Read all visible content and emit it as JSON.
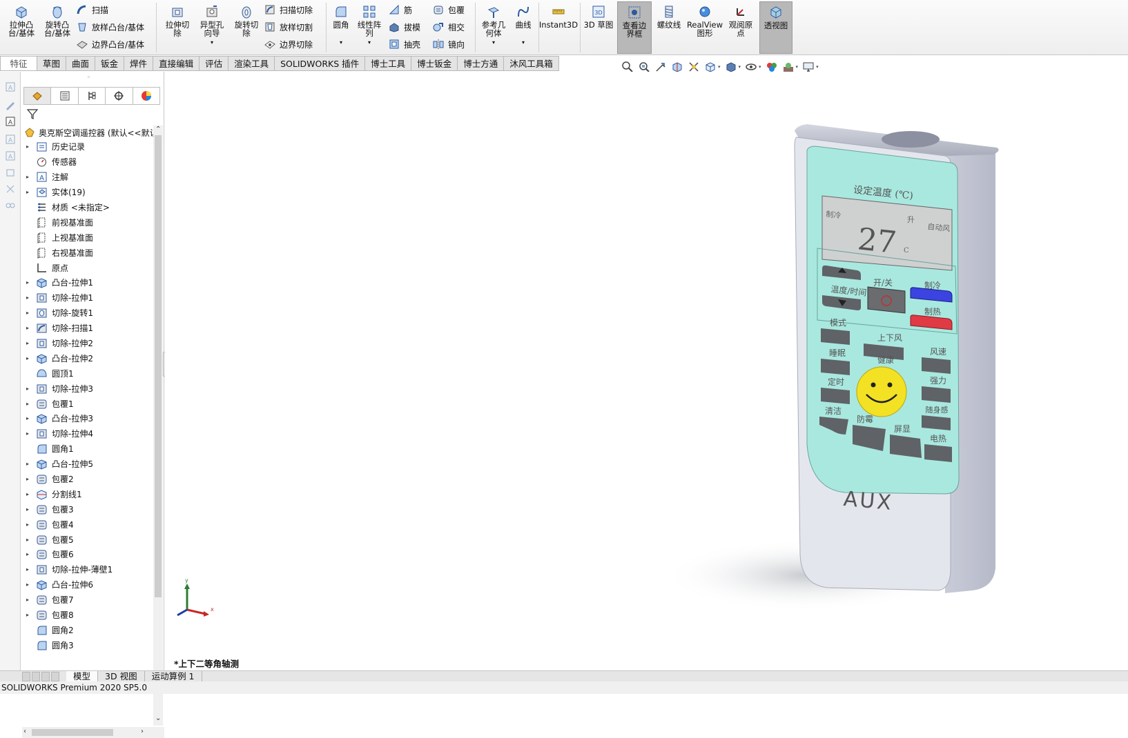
{
  "ribbon": {
    "extrude_boss": "拉伸凸\n台/基体",
    "revolve_boss": "旋转凸\n台/基体",
    "sweep": "扫描",
    "loft_boss": "放样凸台/基体",
    "boundary_boss": "边界凸台/基体",
    "extrude_cut": "拉伸切\n除",
    "hole_wizard": "异型孔\n向导",
    "revolve_cut": "旋转切\n除",
    "swept_cut": "扫描切除",
    "lofted_cut": "放样切割",
    "boundary_cut": "边界切除",
    "fillet": "圆角",
    "linear_pattern": "线性阵\n列",
    "rib": "筋",
    "draft": "拔模",
    "shell": "抽壳",
    "wrap": "包覆",
    "intersect": "相交",
    "mirror": "镜向",
    "ref_geometry": "参考几\n何体",
    "curves": "曲线",
    "instant3d": "Instant3D",
    "sketch3d": "3D 草图",
    "bounding_box": "查看边\n界框",
    "thread": "螺纹线",
    "realview": "RealView\n图形",
    "view_origin": "观阅原\n点",
    "transparent": "透视图"
  },
  "command_tabs": [
    "特征",
    "草图",
    "曲面",
    "钣金",
    "焊件",
    "直接编辑",
    "评估",
    "渲染工具",
    "SOLIDWORKS 插件",
    "博士工具",
    "博士钣金",
    "博士方通",
    "沐风工具箱"
  ],
  "tree": {
    "root": "奥克斯空调遥控器 (默认<<默认",
    "items": [
      {
        "label": "历史记录",
        "icon": "history-icon",
        "expand": true
      },
      {
        "label": "传感器",
        "icon": "sensor-icon",
        "expand": false
      },
      {
        "label": "注解",
        "icon": "annotation-icon",
        "expand": true
      },
      {
        "label": "实体(19)",
        "icon": "solid-bodies-icon",
        "expand": true
      },
      {
        "label": "材质 <未指定>",
        "icon": "material-icon",
        "expand": false
      },
      {
        "label": "前视基准面",
        "icon": "plane-icon",
        "expand": false
      },
      {
        "label": "上视基准面",
        "icon": "plane-icon",
        "expand": false
      },
      {
        "label": "右视基准面",
        "icon": "plane-icon",
        "expand": false
      },
      {
        "label": "原点",
        "icon": "origin-icon",
        "expand": false
      },
      {
        "label": "凸台-拉伸1",
        "icon": "boss-extrude-icon",
        "expand": true
      },
      {
        "label": "切除-拉伸1",
        "icon": "cut-extrude-icon",
        "expand": true
      },
      {
        "label": "切除-旋转1",
        "icon": "cut-revolve-icon",
        "expand": true
      },
      {
        "label": "切除-扫描1",
        "icon": "cut-sweep-icon",
        "expand": true
      },
      {
        "label": "切除-拉伸2",
        "icon": "cut-extrude-icon",
        "expand": true
      },
      {
        "label": "凸台-拉伸2",
        "icon": "boss-extrude-icon",
        "expand": true
      },
      {
        "label": "圆顶1",
        "icon": "dome-icon",
        "expand": false
      },
      {
        "label": "切除-拉伸3",
        "icon": "cut-extrude-icon",
        "expand": true
      },
      {
        "label": "包覆1",
        "icon": "wrap-icon",
        "expand": true
      },
      {
        "label": "凸台-拉伸3",
        "icon": "boss-extrude-icon",
        "expand": true
      },
      {
        "label": "切除-拉伸4",
        "icon": "cut-extrude-icon",
        "expand": true
      },
      {
        "label": "圆角1",
        "icon": "fillet-icon",
        "expand": false
      },
      {
        "label": "凸台-拉伸5",
        "icon": "boss-extrude-icon",
        "expand": true
      },
      {
        "label": "包覆2",
        "icon": "wrap-icon",
        "expand": true
      },
      {
        "label": "分割线1",
        "icon": "split-line-icon",
        "expand": true
      },
      {
        "label": "包覆3",
        "icon": "wrap-icon",
        "expand": true
      },
      {
        "label": "包覆4",
        "icon": "wrap-icon",
        "expand": true
      },
      {
        "label": "包覆5",
        "icon": "wrap-icon",
        "expand": true
      },
      {
        "label": "包覆6",
        "icon": "wrap-icon",
        "expand": true
      },
      {
        "label": "切除-拉伸-薄壁1",
        "icon": "cut-extrude-icon",
        "expand": true
      },
      {
        "label": "凸台-拉伸6",
        "icon": "boss-extrude-icon",
        "expand": true
      },
      {
        "label": "包覆7",
        "icon": "wrap-icon",
        "expand": true
      },
      {
        "label": "包覆8",
        "icon": "wrap-icon",
        "expand": true
      },
      {
        "label": "圆角2",
        "icon": "fillet-icon",
        "expand": false
      },
      {
        "label": "圆角3",
        "icon": "fillet-icon",
        "expand": false
      }
    ]
  },
  "model": {
    "screen_title": "设定温度 (℃)",
    "mode_cool": "制冷",
    "temp_value": "27",
    "temp_unit": "C",
    "rise_label": "升",
    "auto_label": "自动风",
    "btn_temp_time": "温度/时间",
    "btn_onoff": "开/关",
    "btn_cool": "制冷",
    "btn_heat": "制热",
    "btn_mode": "模式",
    "btn_swing_ud": "上下风",
    "btn_sleep": "睡眠",
    "btn_health": "健康",
    "btn_speed": "风速",
    "btn_timer": "定时",
    "btn_strong": "强力",
    "btn_clean": "清洁",
    "btn_antimold": "防霉",
    "btn_display": "屏显",
    "btn_follow": "随身感",
    "btn_elec_heat": "电热",
    "brand": "AUX",
    "colors": {
      "face": "#a9e8df",
      "body": "#e4e6ee",
      "cool_btn": "#3b44e0",
      "heat_btn": "#e03a45",
      "smiley": "#f3e124"
    }
  },
  "axes": {
    "x": "x",
    "y": "y"
  },
  "view_label": "*上下二等角轴测",
  "bottom_tabs": [
    "模型",
    "3D 视图",
    "运动算例 1"
  ],
  "status": "SOLIDWORKS Premium 2020 SP5.0"
}
